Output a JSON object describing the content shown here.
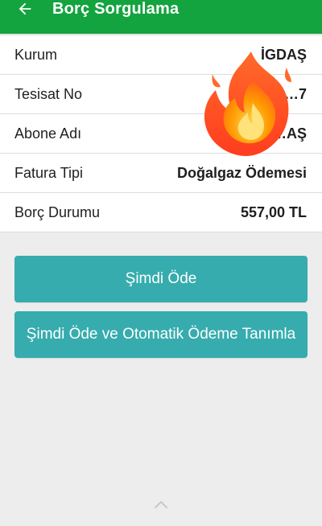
{
  "header": {
    "title": "Borç Sorgulama",
    "back_icon": "arrow-left-icon",
    "background_color": "#13a33f"
  },
  "details": {
    "rows": [
      {
        "label": "Kurum",
        "value": "İGDAŞ"
      },
      {
        "label": "Tesisat No",
        "value": "5…7"
      },
      {
        "label": "Abone Adı",
        "value": "R…AŞ"
      },
      {
        "label": "Fatura Tipi",
        "value": "Doğalgaz Ödemesi"
      },
      {
        "label": "Borç Durumu",
        "value": "557,00 TL"
      }
    ]
  },
  "actions": {
    "pay_now": "Şimdi Öde",
    "pay_now_and_autopay": "Şimdi Öde ve Otomatik Ödeme Tanımla",
    "button_color": "#36acae"
  },
  "overlay": {
    "icon": "fire-emoji-icon"
  },
  "bottom": {
    "icon": "chevron-up-icon"
  }
}
